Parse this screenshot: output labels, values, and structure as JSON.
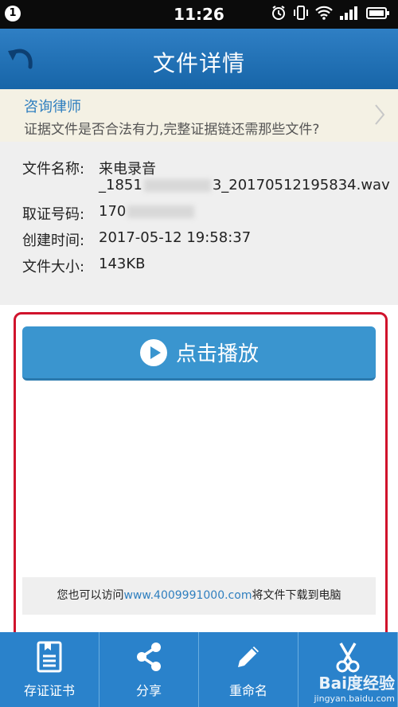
{
  "status_bar": {
    "notification_count": "1",
    "time": "11:26"
  },
  "header": {
    "title": "文件详情"
  },
  "banner": {
    "title": "咨询律师",
    "text": "证据文件是否合法有力,完整证据链还需那些文件?"
  },
  "file_info": {
    "name_label": "文件名称:",
    "name_line1": "来电录音",
    "name_line2_a": "_1851",
    "name_line2_b": "3_20170512195834.wav",
    "number_label": "取证号码:",
    "number_value": "170",
    "created_label": "创建时间:",
    "created_value": "2017-05-12 19:58:37",
    "size_label": "文件大小:",
    "size_value": "143KB"
  },
  "play_button": {
    "label": "点击播放"
  },
  "download_note": {
    "prefix": "您也可以访问",
    "link": "www.4009991000.com",
    "suffix": "将文件下载到电脑"
  },
  "tabs": [
    {
      "label": "存证证书",
      "icon": "certificate-icon"
    },
    {
      "label": "分享",
      "icon": "share-icon"
    },
    {
      "label": "重命名",
      "icon": "pencil-icon"
    },
    {
      "label": "",
      "icon": "scissors-icon"
    }
  ],
  "watermark": {
    "brand": "Bai度经验",
    "url": "jingyan.baidu.com"
  },
  "colors": {
    "header": "#1f6fb4",
    "accent": "#2f7fbf",
    "tabbar": "#2a82cb",
    "highlight": "#d0132c"
  }
}
